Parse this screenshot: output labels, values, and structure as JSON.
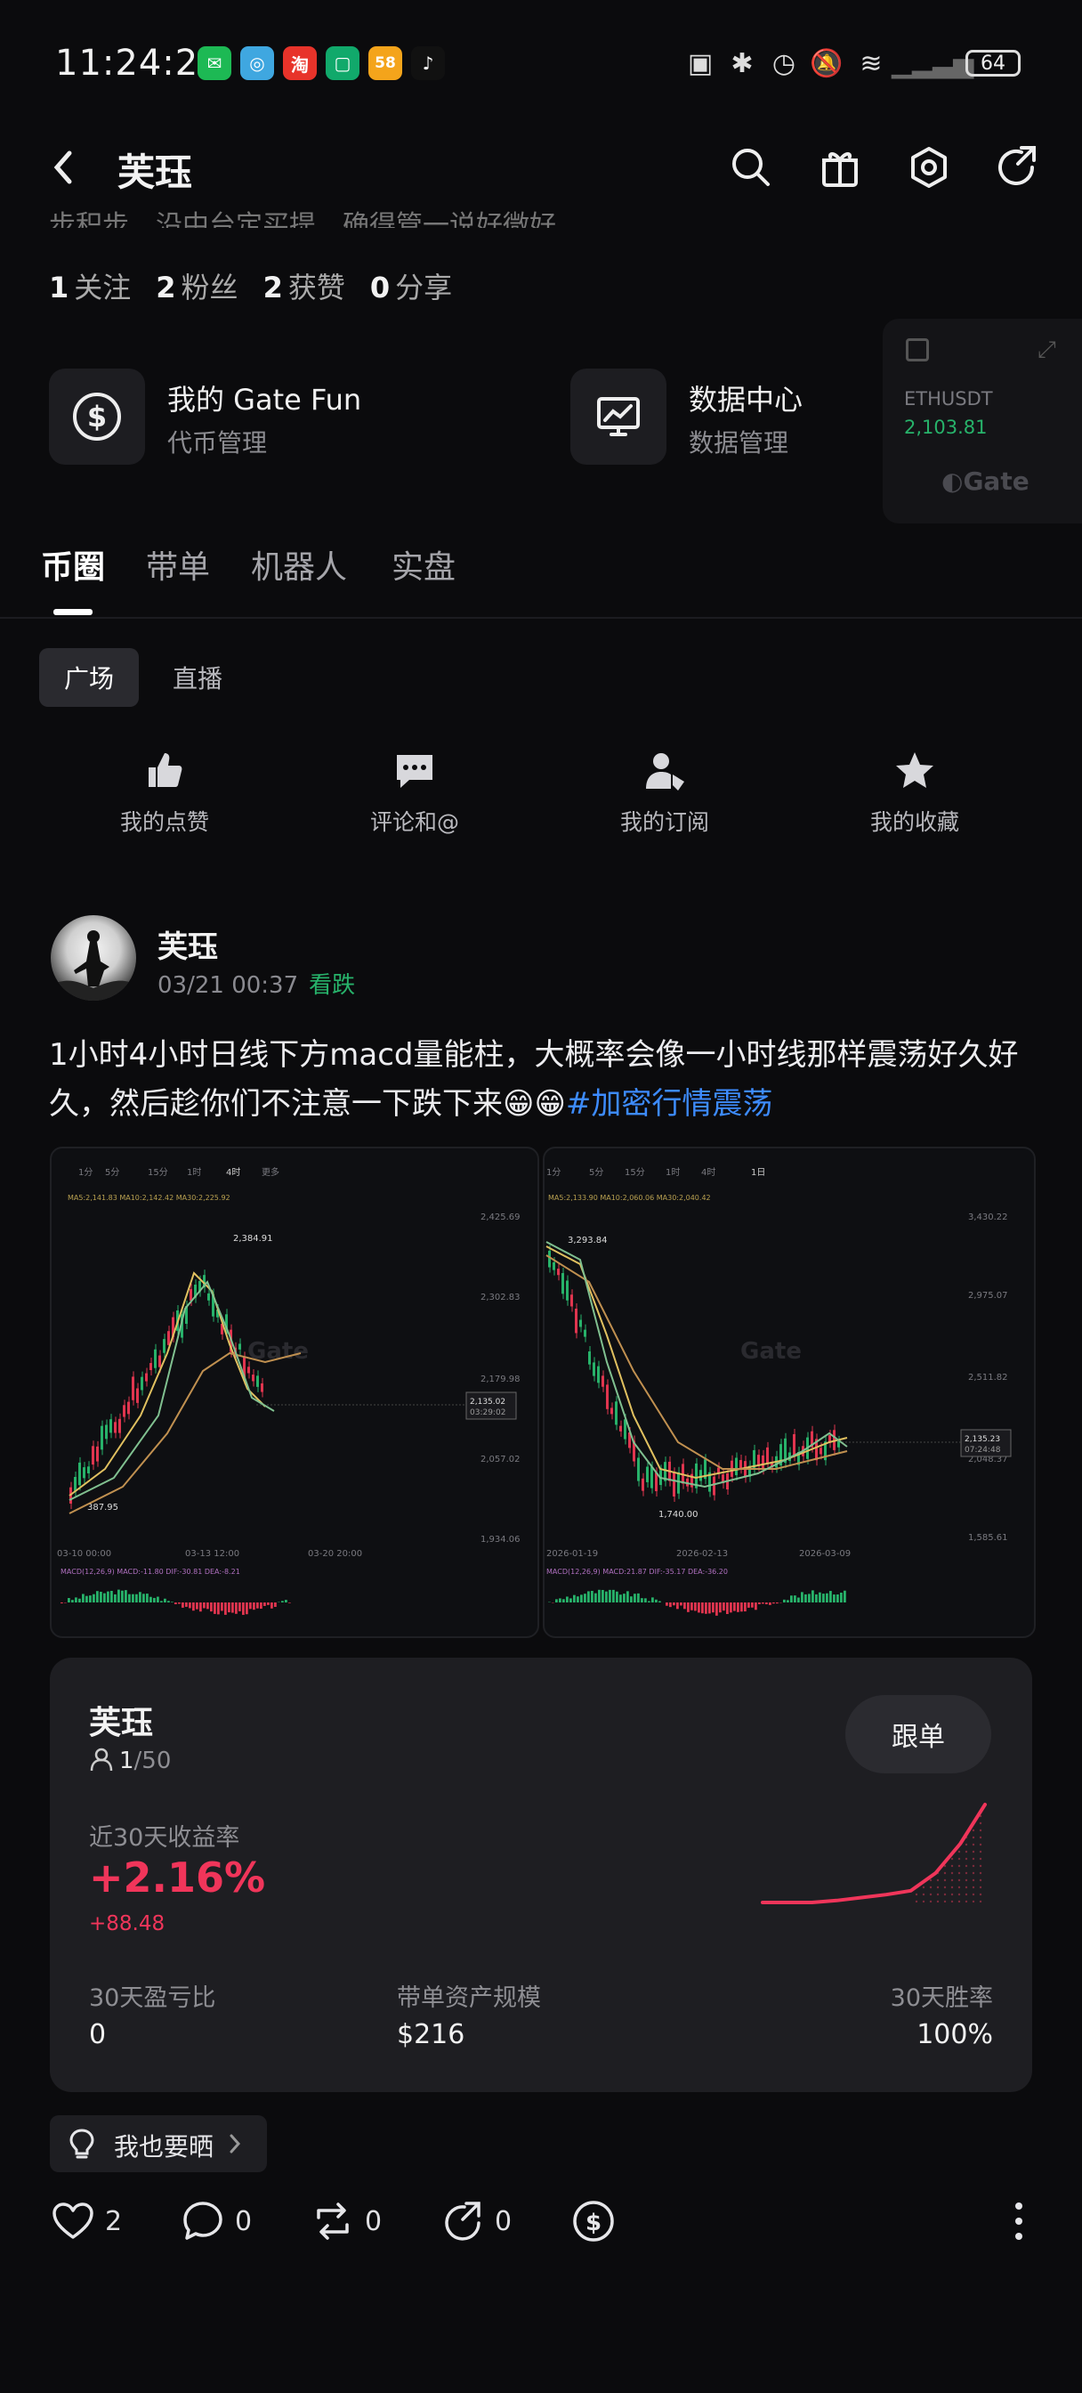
{
  "status_bar": {
    "time": "11:24:22",
    "apps": [
      "wechat-icon",
      "browser-icon",
      "taobao-icon",
      "message-icon",
      "58-icon",
      "tiktok-icon"
    ],
    "battery": "64"
  },
  "header": {
    "title": "芙珏",
    "cut_bio": "步积步，沿中台定买提，确得管一说好微好"
  },
  "stats": [
    {
      "value": "1",
      "label": "关注"
    },
    {
      "value": "2",
      "label": "粉丝"
    },
    {
      "value": "2",
      "label": "获赞"
    },
    {
      "value": "0",
      "label": "分享"
    }
  ],
  "features": [
    {
      "title": "我的 Gate Fun",
      "subtitle": "代币管理"
    },
    {
      "title": "数据中心",
      "subtitle": "数据管理"
    }
  ],
  "ticker": {
    "symbol": "ETHUSDT",
    "price": "2,103.81",
    "brand": "Gate"
  },
  "tabs": [
    "币圈",
    "带单",
    "机器人",
    "实盘"
  ],
  "subtabs": [
    "广场",
    "直播"
  ],
  "quick_actions": [
    "我的点赞",
    "评论和@",
    "我的订阅",
    "我的收藏"
  ],
  "post": {
    "author": "芙珏",
    "datetime": "03/21 00:37",
    "sentiment": "看跌",
    "text": "1小时4小时日线下方macd量能柱，大概率会像一小时线那样震荡好久好久，然后趁你们不注意一下跌下来😁😁",
    "hashtag": "#加密行情震荡",
    "chart_left": {
      "tabs": [
        "1分",
        "5分",
        "15分",
        "1时",
        "4时",
        "更多"
      ],
      "high_label": "2,384.91",
      "low_label": "387.95",
      "price_tag": "2,135.02",
      "price_sub": "03:29:02",
      "axis": [
        "2,425.69",
        "2,302.83",
        "2,179.98",
        "2,057.02",
        "1,934.06"
      ],
      "dates": [
        "03-10 00:00",
        "03-13 12:00",
        "03-20 20:00"
      ],
      "macd": "MACD(12,26,9)  MACD:-11.80  DIF:-30.81  DEA:-8.21",
      "ma": "MA5:2,141.83  MA10:2,142.42  MA30:2,225.92"
    },
    "chart_right": {
      "tabs": [
        "1分",
        "5分",
        "15分",
        "1时",
        "4时",
        "1日"
      ],
      "high_label": "3,293.84",
      "low_label": "1,740.00",
      "price_tag": "2,135.23",
      "price_sub": "07:24:48",
      "axis": [
        "3,430.22",
        "2,975.07",
        "2,511.82",
        "2,048.37",
        "1,585.61"
      ],
      "dates": [
        "2026-01-19",
        "2026-02-13",
        "2026-03-09"
      ],
      "macd": "MACD(12,26,9)  MACD:21.87  DIF:-35.17  DEA:-36.20",
      "ma": "MA5:2,133.90  MA10:2,060.06  MA30:2,040.42"
    }
  },
  "copy_card": {
    "name": "芙珏",
    "followers": "1",
    "followers_max": "/50",
    "button": "跟单",
    "roi_label": "近30天收益率",
    "roi": "+2.16%",
    "pnl": "+88.48",
    "spark": [
      0,
      0,
      0,
      0.02,
      0.05,
      0.08,
      0.12,
      0.3,
      0.6,
      1.0
    ],
    "stats": [
      {
        "label": "30天盈亏比",
        "value": "0"
      },
      {
        "label": "带单资产规模",
        "value": "$216"
      },
      {
        "label": "30天胜率",
        "value": "100%"
      }
    ]
  },
  "share_prompt": "我也要晒",
  "actions": {
    "like": "2",
    "comment": "0",
    "repost": "0",
    "share": "0"
  },
  "colors": {
    "up": "#27b26a",
    "down": "#f0355a",
    "link": "#3d8bfd",
    "bg": "#0b0b0d"
  }
}
